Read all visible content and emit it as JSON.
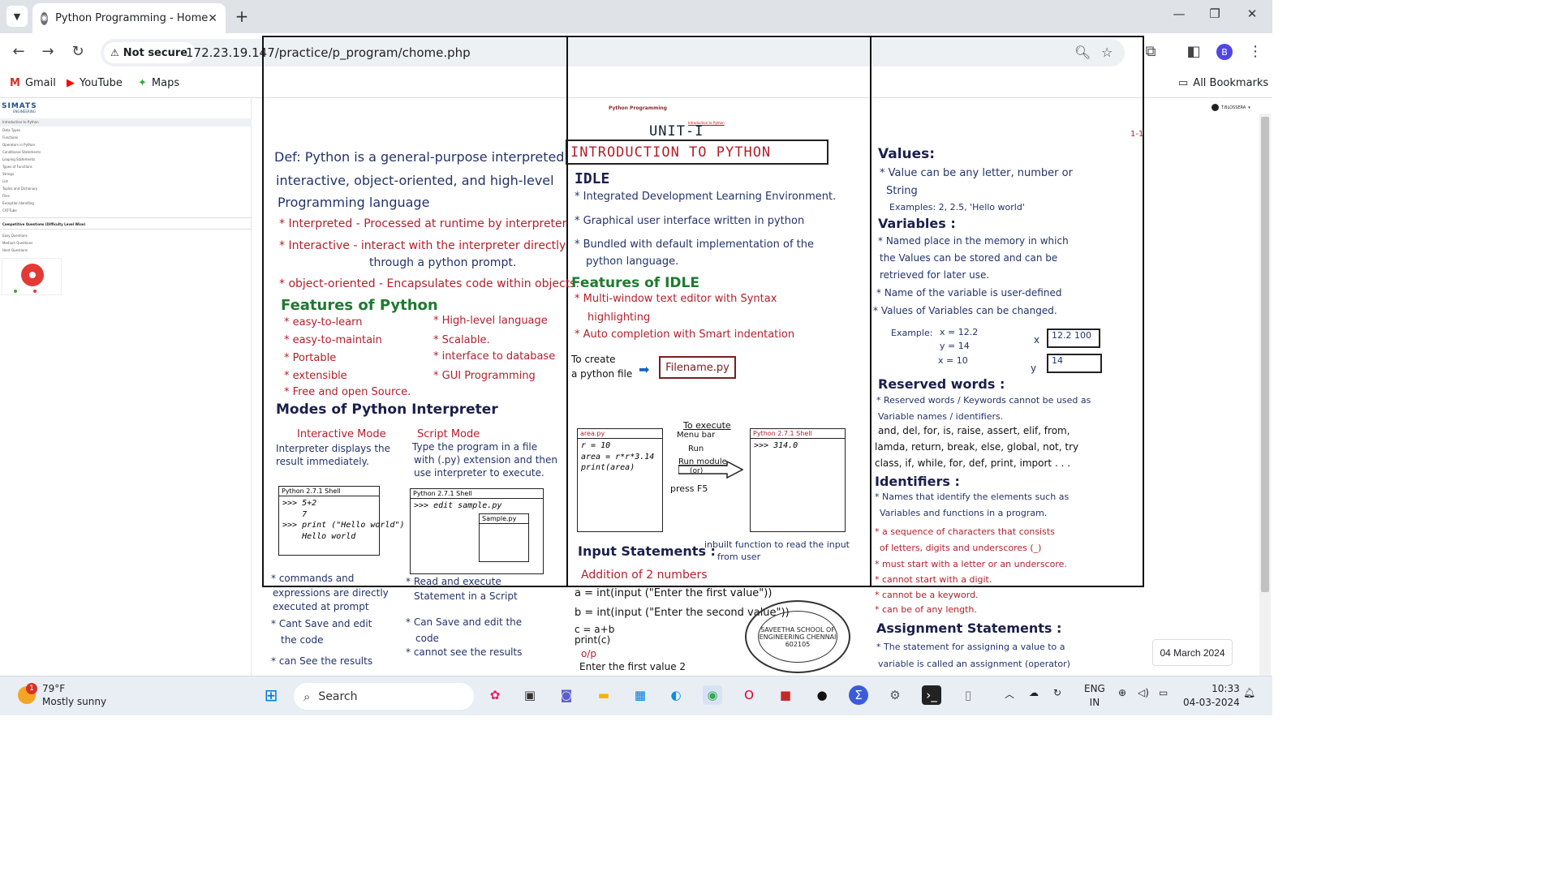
{
  "browser": {
    "tab_title": "Python Programming - Home",
    "security_label": "Not secure",
    "url": "172.23.19.147/practice/p_program/chome.php",
    "profile_initial": "B",
    "bookmarks": [
      {
        "label": "Gmail",
        "icon": "gmail-icon"
      },
      {
        "label": "YouTube",
        "icon": "youtube-icon"
      },
      {
        "label": "Maps",
        "icon": "maps-icon"
      }
    ],
    "all_bookmarks": "All Bookmarks"
  },
  "site": {
    "logo": "SIMATS",
    "logo_sub": "ENGINEERING",
    "page_title": "Python Programming",
    "breadcrumb": "Introduction to Python",
    "user": "T.BLOSSERA",
    "sidebar": [
      "Introduction to Python",
      "Data Types",
      "Functions",
      "Operators in Python",
      "Conditional Statements",
      "Looping Statements",
      "Types of Functions",
      "Strings",
      "List",
      "Tuples and Dictionary",
      "Files",
      "Exception Handling",
      "CAT-Tube"
    ],
    "sidebar_section": "Competitive Questions (Difficulty Level Wise)",
    "sidebar_questions": [
      "Easy Questions",
      "Medium Questions",
      "Hard Questions"
    ]
  },
  "notes": {
    "unit": "UNIT-I",
    "page_no": "1-1",
    "heading": "INTRODUCTION TO PYTHON",
    "col1": {
      "def_1": "Def: Python is a general-purpose interpreted,",
      "def_2": "interactive, object-oriented, and high-level",
      "def_3": "Programming language",
      "interp_1": "* Interpreted - Processed at runtime by interpreter",
      "interact_1": "* Interactive - interact with the interpreter directly",
      "interact_2": "through a python prompt.",
      "oop_1": "* object-oriented - Encapsulates code within objects.",
      "features_title": "Features of Python",
      "f_left": [
        "* easy-to-learn",
        "* easy-to-maintain",
        "* Portable",
        "* extensible",
        "* Free and open Source."
      ],
      "f_right": [
        "* High-level language",
        "* Scalable.",
        "* interface to database",
        "* GUI Programming"
      ],
      "modes_title": "Modes of Python Interpreter",
      "mode_interactive": "Interactive Mode",
      "mode_script": "Script Mode",
      "interactive_desc_1": "Interpreter displays the",
      "interactive_desc_2": "result immediately.",
      "script_desc_1": "Type the program in a file",
      "script_desc_2": "with (.py) extension and then",
      "script_desc_3": "use interpreter to execute.",
      "shell1_title": "Python 2.7.1 Shell",
      "shell1_body": ">>> 5+2\n    7\n>>> print (\"Hello world\")\n    Hello world",
      "shell2_title": "Python 2.7.1 Shell",
      "shell2_body": ">>> edit sample.py",
      "shell2_inner": "Sample.py",
      "pts_left": [
        "* commands and",
        "expressions are directly",
        "executed at prompt",
        "* Cant Save and edit",
        "the code",
        "* can See the results"
      ],
      "pts_right": [
        "* Read and execute",
        "Statement in a Script",
        "* Can Save and edit the",
        "code",
        "* cannot see the results"
      ]
    },
    "col2": {
      "idle_title": "IDLE",
      "idle_1": "* Integrated Development Learning Environment.",
      "idle_2": "* Graphical user interface written in python",
      "idle_3": "* Bundled with default implementation of the",
      "idle_4": "python language.",
      "feat_title": "Features of IDLE",
      "feat_1": "* Multi-window text editor with Syntax",
      "feat_2": "highlighting",
      "feat_3": "* Auto completion with Smart indentation",
      "create_1": "To create",
      "create_2": "a python file",
      "filename": "Filename.py",
      "area_title": "area.py",
      "area_body": "r = 10\narea = r*r*3.14\nprint(area)",
      "exec_title": "To execute",
      "exec_1": "Menu bar",
      "exec_2": "Run",
      "exec_3": "Run module",
      "exec_4": "(or)",
      "exec_5": "press F5",
      "shell3_title": "Python 2.7.1 Shell",
      "shell3_body": ">>> 314.0",
      "input_title": "Input Statements :",
      "input_desc_1": "inbuilt function to read the input",
      "input_desc_2": "from user",
      "add_title": "Addition of 2 numbers",
      "code": [
        "a = int(input (\"Enter the first value\"))",
        "b = int(input (\"Enter the second value\"))",
        "c = a+b",
        "print(c)",
        "o/p",
        "Enter the first value 2"
      ],
      "stamp": "SAVEETHA SCHOOL OF ENGINEERING CHENNAI 602105"
    },
    "col3": {
      "values_title": "Values:",
      "values_1": "* Value can be any letter, number or",
      "values_2": "String",
      "values_ex": "Examples: 2, 2.5, 'Hello world'",
      "var_title": "Variables :",
      "var_1": "* Named place in the memory in which",
      "var_2": "the Values can be stored and can be",
      "var_3": "retrieved for later use.",
      "var_4": "* Name of the variable is user-defined",
      "var_5": "* Values of Variables can be changed.",
      "ex_label": "Example:",
      "ex_vals": [
        "x = 12.2",
        "y = 14",
        "x = 10"
      ],
      "box_x": "x",
      "box_x_val": "12.2  100",
      "box_y": "y",
      "box_y_val": "14",
      "rw_title": "Reserved words :",
      "rw_1": "* Reserved words / Keywords cannot be used as",
      "rw_2": "Variable names / identifiers.",
      "rw_3": "and, del, for, is, raise, assert, elif, from,",
      "rw_4": "lamda, return, break, else, global, not, try",
      "rw_5": "class, if, while, for, def, print, import . . .",
      "id_title": "Identifiers :",
      "id_1": "* Names that identify the elements such as",
      "id_2": "Variables and functions in a program.",
      "id_3": "* a sequence of characters that consists",
      "id_4": "of letters, digits and underscores (_)",
      "id_5": "* must start with a letter or an underscore.",
      "id_6": "* cannot start with a digit.",
      "id_7": "* cannot be a keyword.",
      "id_8": "* can be of any length.",
      "as_title": "Assignment Statements :",
      "as_1": "* The statement for assigning a value to a",
      "as_2": "variable is called an assignment (operator)"
    },
    "date_tooltip": "04 March 2024"
  },
  "taskbar": {
    "temp": "79°F",
    "weather": "Mostly sunny",
    "weather_badge": "1",
    "search": "Search",
    "lang_1": "ENG",
    "lang_2": "IN",
    "time": "10:33",
    "date": "04-03-2024"
  }
}
